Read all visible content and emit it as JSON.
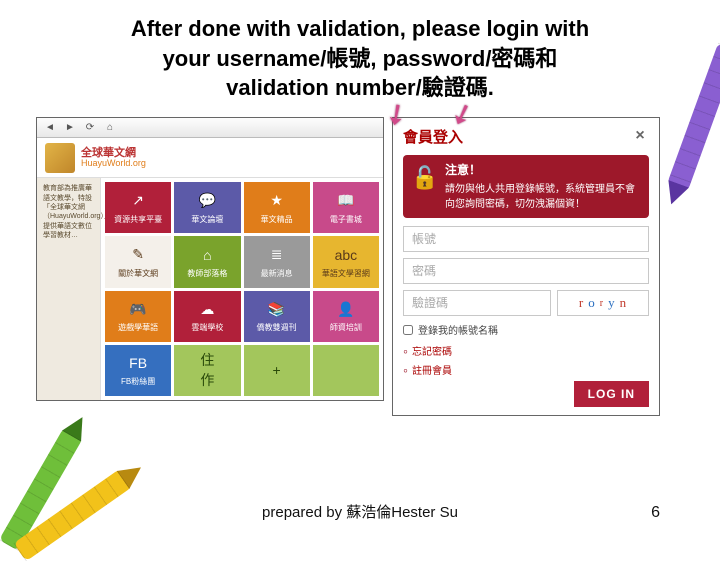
{
  "title_line1": "After done with validation, please login with",
  "title_line2": "your username/帳號, password/密碼和",
  "title_line3": "validation number/驗證碼.",
  "browser": {
    "site_name_cn": "全球華文網",
    "site_name_en": "HuayuWorld.org",
    "sidebar_blurb": "教育部為推廣華語文教學，特設「全球華文網（HuayuWorld.org）」，提供華語文數位學習教材…",
    "tiles": [
      {
        "label": "資源共享平臺",
        "cls": "t-r",
        "icon": "↗"
      },
      {
        "label": "華文論壇",
        "cls": "t-p",
        "icon": "💬"
      },
      {
        "label": "華文精品",
        "cls": "t-o",
        "icon": "★"
      },
      {
        "label": "電子書城",
        "cls": "t-m",
        "icon": "📖"
      },
      {
        "label": "關於華文網",
        "cls": "t-w",
        "icon": "✎"
      },
      {
        "label": "教師部落格",
        "cls": "t-g",
        "icon": "⌂"
      },
      {
        "label": "最新消息",
        "cls": "t-gr",
        "icon": "≣"
      },
      {
        "label": "華語文學習網",
        "cls": "t-y",
        "icon": "abc"
      },
      {
        "label": "遊戲學華語",
        "cls": "t-o",
        "icon": "🎮"
      },
      {
        "label": "雲端學校",
        "cls": "t-r",
        "icon": "☁"
      },
      {
        "label": "僑教雙週刊",
        "cls": "t-p",
        "icon": "📚"
      },
      {
        "label": "師資培訓",
        "cls": "t-m",
        "icon": "👤"
      },
      {
        "label": "FB粉絲團",
        "cls": "t-b",
        "icon": "FB"
      },
      {
        "label": "",
        "cls": "t-lg",
        "icon": "住作"
      },
      {
        "label": "",
        "cls": "t-lg",
        "icon": "+"
      },
      {
        "label": "",
        "cls": "t-lg",
        "icon": ""
      }
    ]
  },
  "login": {
    "header": "會員登入",
    "warn_title": "注意！",
    "warn_body": "請勿與他人共用登錄帳號，系統管理員不會向您詢問密碼，切勿洩漏個資！",
    "field_user": "帳號",
    "field_pass": "密碼",
    "field_captcha": "驗證碼",
    "captcha": [
      "r",
      "o",
      "r",
      "y",
      "n"
    ],
    "remember": "登錄我的帳號名稱",
    "forgot": "忘記密碼",
    "register": "註冊會員",
    "button": "LOG IN"
  },
  "footer": "prepared by 蘇浩倫Hester Su",
  "slide_num": "6"
}
